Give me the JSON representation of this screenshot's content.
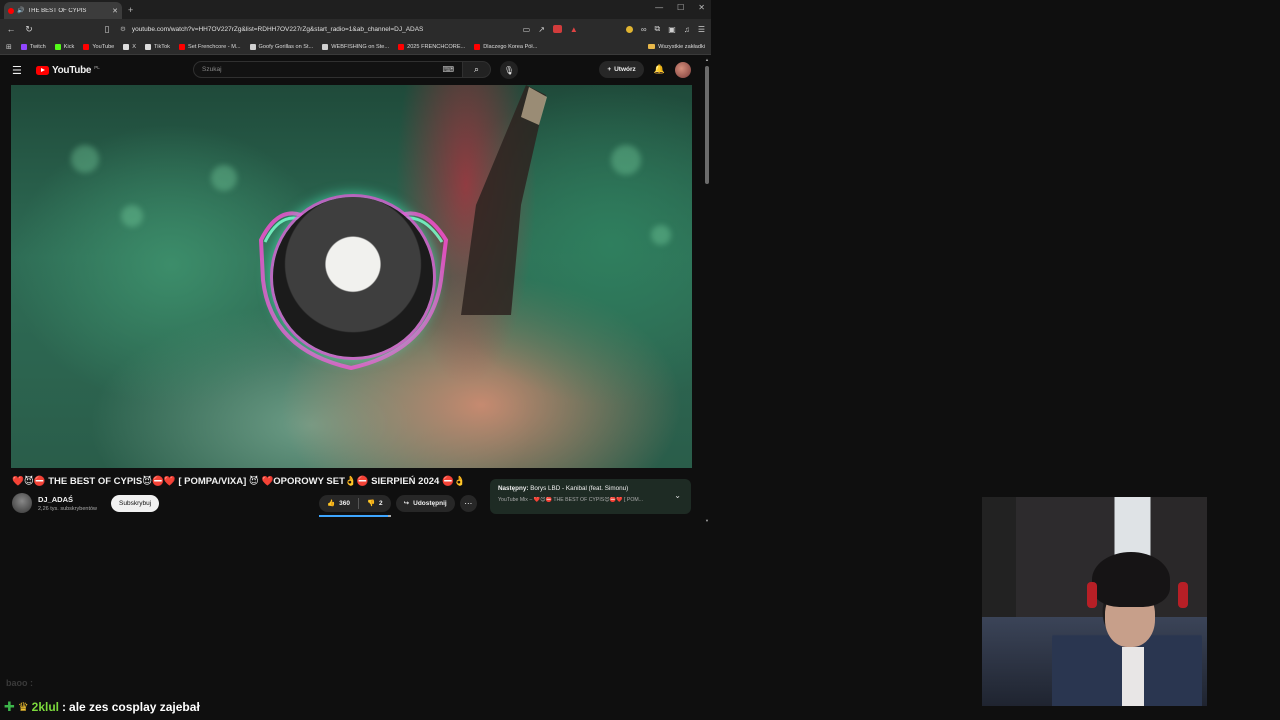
{
  "browser": {
    "tab_title": "THE BEST OF CYPIS",
    "url": "youtube.com/watch?v=HH7OV227rZg&list=RDHH7OV227rZg&start_radio=1&ab_channel=DJ_ADAŚ",
    "bookmarks": [
      {
        "label": "Twitch",
        "color": "#9146ff"
      },
      {
        "label": "Kick",
        "color": "#53fc18"
      },
      {
        "label": "YouTube",
        "color": "#ff0000"
      },
      {
        "label": "X",
        "color": "#ffffff"
      },
      {
        "label": "TikTok",
        "color": "#ffffff"
      },
      {
        "label": "Set Frenchcore - M...",
        "color": "#ff0000"
      },
      {
        "label": "Goofy Gorillas on St...",
        "color": "#cfcfcf"
      },
      {
        "label": "WEBFISHING on Ste...",
        "color": "#cfcfcf"
      },
      {
        "label": "2025 FRENCHCORE...",
        "color": "#ff0000"
      },
      {
        "label": "Dlaczego Korea Pół...",
        "color": "#ff0000"
      }
    ],
    "bookmarks_folder": "Wszystkie zakładki"
  },
  "youtube": {
    "logo": "YouTube",
    "region": "PL",
    "search_placeholder": "Szukaj",
    "create_label": "Utwórz",
    "video_title": "❤️😈⛔ THE BEST OF CYPIS😈⛔❤️ [ POMPA/VIXA] 😈 ❤️OPOROWY SET👌⛔ SIERPIEŃ 2024 ⛔👌",
    "channel_name": "DJ_ADAŚ",
    "channel_subs": "2,26 tys. subskrybentów",
    "subscribe_label": "Subskrybuj",
    "likes": "360",
    "dislikes": "2",
    "share_label": "Udostępnij",
    "next_label": "Następny:",
    "next_title": "Borys LBD - Kanibal (feat. Simonu)",
    "next_mix": "YouTube Mix – ❤️😈⛔ THE BEST OF CYPIS😈⛔❤️ [ POM..."
  },
  "chat": {
    "faint_user": "baoo :",
    "user": "2klul",
    "separator": ":",
    "message": "ale zes cosplay zajebał"
  },
  "icons": {
    "back": "arrow-left-icon",
    "reload": "reload-icon",
    "search": "search-icon",
    "mic": "mic-icon",
    "bell": "bell-icon"
  }
}
